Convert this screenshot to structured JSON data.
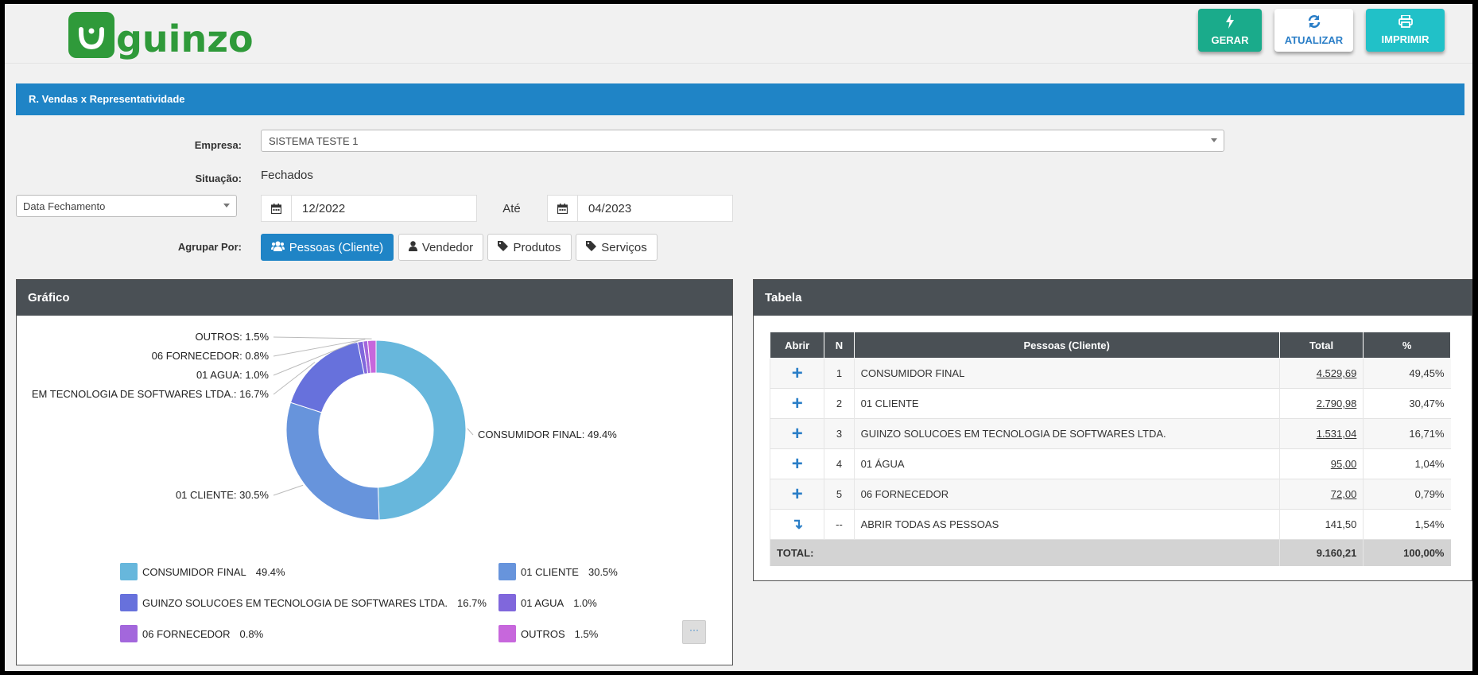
{
  "header": {
    "logo_text": "guinzo",
    "buttons": {
      "gerar": "GERAR",
      "atualizar": "ATUALIZAR",
      "imprimir": "IMPRIMIR"
    }
  },
  "page_title": "R. Vendas x Representatividade",
  "filters": {
    "empresa_label": "Empresa:",
    "empresa_value": "SISTEMA TESTE 1",
    "situacao_label": "Situação:",
    "situacao_value": "Fechados",
    "date_type": "Data Fechamento",
    "date_from": "12/2022",
    "ate_label": "Até",
    "date_to": "04/2023",
    "agrupar_label": "Agrupar Por:",
    "agrupar_options": [
      "Pessoas (Cliente)",
      "Vendedor",
      "Produtos",
      "Serviços"
    ],
    "agrupar_selected": "Pessoas (Cliente)"
  },
  "chart_panel_title": "Gráfico",
  "table_panel_title": "Tabela",
  "chart_data": {
    "type": "pie",
    "donut": true,
    "categories": [
      "CONSUMIDOR FINAL",
      "01 CLIENTE",
      "GUINZO SOLUCOES EM TECNOLOGIA DE SOFTWARES LTDA.",
      "01 AGUA",
      "06 FORNECEDOR",
      "OUTROS"
    ],
    "values": [
      49.4,
      30.5,
      16.7,
      1.0,
      0.8,
      1.5
    ],
    "slice_labels": [
      "CONSUMIDOR FINAL: 49.4%",
      "01 CLIENTE: 30.5%",
      "EM TECNOLOGIA DE SOFTWARES LTDA.: 16.7%",
      "01 AGUA: 1.0%",
      "06 FORNECEDOR: 0.8%",
      "OUTROS: 1.5%"
    ],
    "colors": [
      "#67b7dc",
      "#6794dc",
      "#6771dc",
      "#8067dc",
      "#a367dc",
      "#c767dc"
    ],
    "legend": [
      {
        "name": "CONSUMIDOR FINAL",
        "pct": "49.4%"
      },
      {
        "name": "01 CLIENTE",
        "pct": "30.5%"
      },
      {
        "name": "GUINZO SOLUCOES EM TECNOLOGIA DE SOFTWARES LTDA.",
        "pct": "16.7%"
      },
      {
        "name": "01 AGUA",
        "pct": "1.0%"
      },
      {
        "name": "06 FORNECEDOR",
        "pct": "0.8%"
      },
      {
        "name": "OUTROS",
        "pct": "1.5%"
      }
    ],
    "legend_more": "···"
  },
  "table": {
    "headers": [
      "Abrir",
      "N",
      "Pessoas (Cliente)",
      "Total",
      "%"
    ],
    "rows": [
      {
        "n": "1",
        "name": "CONSUMIDOR FINAL",
        "total": "4.529,69",
        "pct": "49,45%"
      },
      {
        "n": "2",
        "name": "01 CLIENTE",
        "total": "2.790,98",
        "pct": "30,47%"
      },
      {
        "n": "3",
        "name": "GUINZO SOLUCOES EM TECNOLOGIA DE SOFTWARES LTDA.",
        "total": "1.531,04",
        "pct": "16,71%"
      },
      {
        "n": "4",
        "name": "01 ÁGUA",
        "total": "95,00",
        "pct": "1,04%"
      },
      {
        "n": "5",
        "name": "06 FORNECEDOR",
        "total": "72,00",
        "pct": "0,79%"
      }
    ],
    "open_all": {
      "n": "--",
      "name": "ABRIR TODAS AS PESSOAS",
      "total": "141,50",
      "pct": "1,54%"
    },
    "total_row": {
      "label": "TOTAL:",
      "total": "9.160,21",
      "pct": "100,00%"
    }
  }
}
